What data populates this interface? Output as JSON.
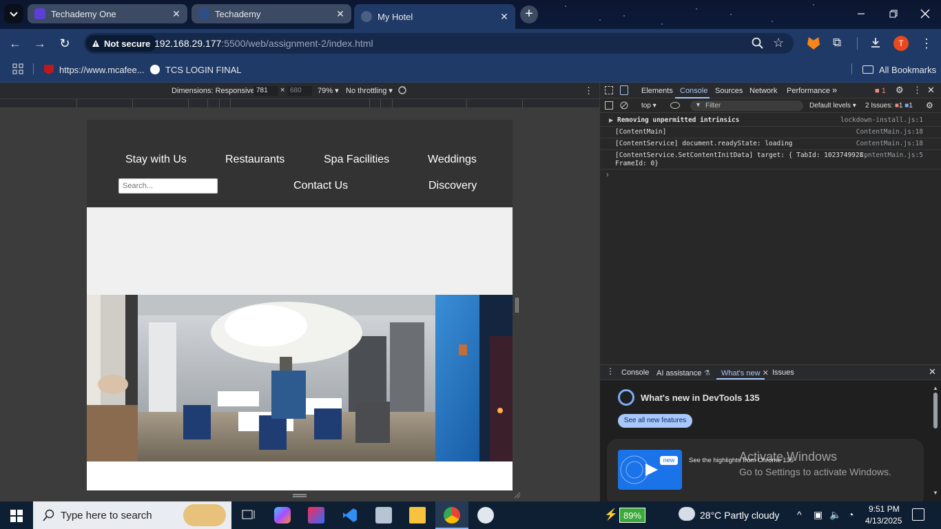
{
  "browser": {
    "tabs": [
      {
        "title": "Techademy One",
        "active": false
      },
      {
        "title": "Techademy",
        "active": false
      },
      {
        "title": "My Hotel",
        "active": true
      }
    ],
    "security_label": "Not secure",
    "url_host": "192.168.29.177",
    "url_rest": ":5500/web/assignment-2/index.html",
    "avatar_letter": "T",
    "bookmarks": [
      {
        "label": "https://www.mcafee...",
        "icon": "mcafee-icon"
      },
      {
        "label": "TCS LOGIN FINAL",
        "icon": "tcs-icon"
      }
    ],
    "all_bookmarks_label": "All Bookmarks"
  },
  "device_toolbar": {
    "dimensions_label": "Dimensions: Responsive",
    "width": "781",
    "times": "×",
    "height": "680",
    "zoom": "79%",
    "throttling": "No throttling"
  },
  "site": {
    "nav": {
      "stay": "Stay with Us",
      "restaurants": "Restaurants",
      "spa": "Spa Facilities",
      "weddings": "Weddings",
      "contact": "Contact Us",
      "discovery": "Discovery"
    },
    "search_placeholder": "Search..."
  },
  "devtools": {
    "tabs": [
      "Elements",
      "Console",
      "Sources",
      "Network",
      "Performance"
    ],
    "active_tab": "Console",
    "error_count": "1",
    "context": "top",
    "filter_placeholder": "Filter",
    "levels": "Default levels",
    "issues_label": "2 Issues:",
    "issues_errors": "1",
    "issues_info": "1",
    "console_lines": [
      {
        "text": "Removing unpermitted intrinsics",
        "source": "lockdown-install.js:1"
      },
      {
        "text": "[ContentMain]",
        "source": "ContentMain.js:18"
      },
      {
        "text": "[ContentService] document.readyState: loading",
        "source": "ContentMain.js:18"
      },
      {
        "text": "[ContentService.SetContentInitData] target: { TabId: 1023749928,",
        "text2": "FrameId: 0}",
        "source": "ContentMain.js:5"
      }
    ],
    "drawer_tabs": [
      "Console",
      "AI assistance",
      "What's new",
      "Issues"
    ],
    "whats_new_title": "What's new in DevTools 135",
    "see_all": "See all new features",
    "highlights": "See the highlights from Chrome 135",
    "badge_new": "new"
  },
  "watermark": {
    "line1": "Activate Windows",
    "line2": "Go to Settings to activate Windows."
  },
  "taskbar": {
    "search_placeholder": "Type here to search",
    "battery": "89%",
    "weather": "28°C  Partly cloudy",
    "time": "9:51 PM",
    "date": "4/13/2025"
  },
  "colors": {
    "site_header": "#333333",
    "devtools_accent": "#a8c7fa",
    "chrome_frame": "#1f3a66"
  }
}
